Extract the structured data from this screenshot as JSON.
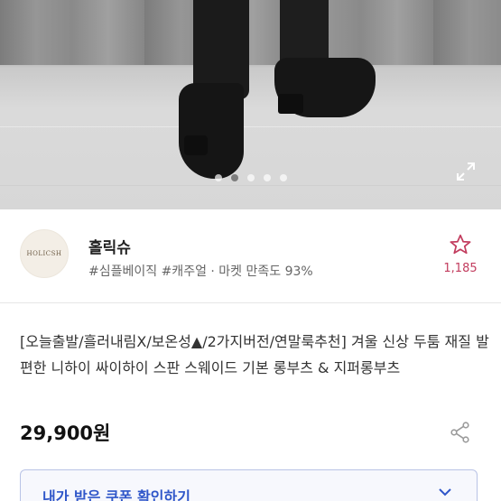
{
  "carousel": {
    "dot_count": 5,
    "active_index": 1
  },
  "shop": {
    "logo_text": "HOLICSH",
    "name": "홀릭슈",
    "tags": "#심플베이직 #캐주얼 · 마켓 만족도 93%",
    "wish_count": "1,185"
  },
  "product": {
    "title": "[오늘출발/흘러내림X/보온성▲/2가지버전/연말룩추천] 겨울 신상 두툼 재질 발편한 니하이 싸이하이 스판 스웨이드 기본 롱부츠 & 지퍼롱부츠",
    "price": "29,900원"
  },
  "coupon": {
    "label": "내가 받은 쿠폰 확인하기"
  },
  "colors": {
    "accent_blue": "#2f56c9",
    "wish_pink": "#c23c5e"
  }
}
